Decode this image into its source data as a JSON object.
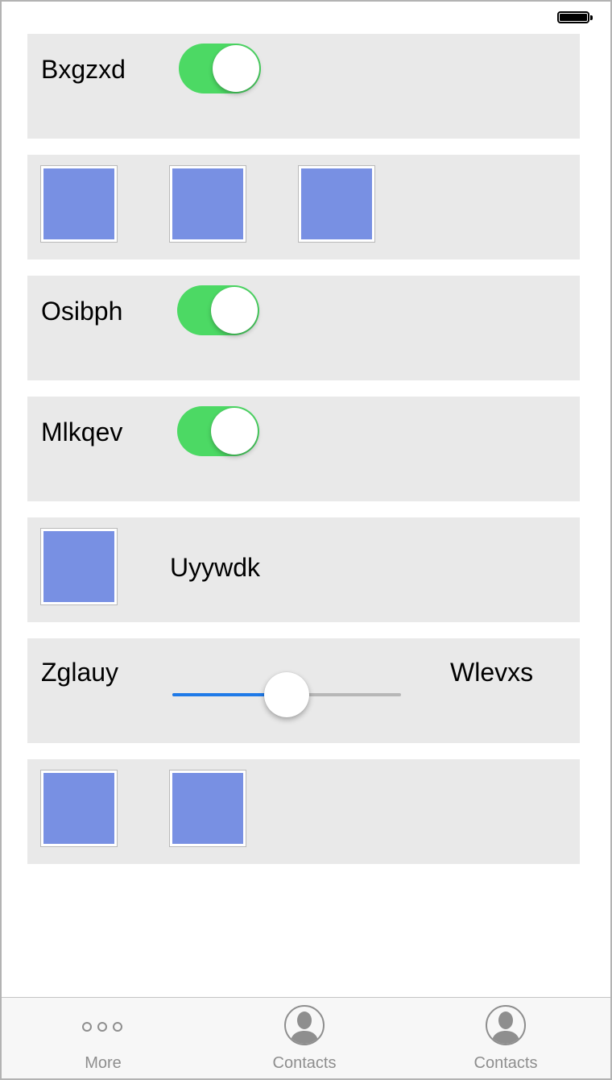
{
  "status_bar": {
    "battery_icon": "battery-icon"
  },
  "rows": {
    "row1": {
      "label": "Bxgzxd",
      "toggle_on": true
    },
    "row2": {
      "tiles": 3
    },
    "row3": {
      "label": "Osibph",
      "toggle_on": true
    },
    "row4": {
      "label": "Mlkqev",
      "toggle_on": true
    },
    "row5": {
      "label": "Uyywdk"
    },
    "row6": {
      "left_label": "Zglauy",
      "right_label": "Wlevxs",
      "slider_value": 0.5
    },
    "row7": {
      "tiles": 2
    }
  },
  "tabbar": {
    "tabs": [
      {
        "label": "More",
        "icon": "more-icon"
      },
      {
        "label": "Contacts",
        "icon": "contacts-icon"
      },
      {
        "label": "Contacts",
        "icon": "contacts-icon"
      }
    ]
  },
  "colors": {
    "toggle_on": "#4cd964",
    "tile_fill": "#7890e3",
    "row_bg": "#e9e9e9",
    "slider_fill": "#1f7ae8",
    "slider_track": "#b7b7b7",
    "tab_text": "#8e8e8e"
  }
}
